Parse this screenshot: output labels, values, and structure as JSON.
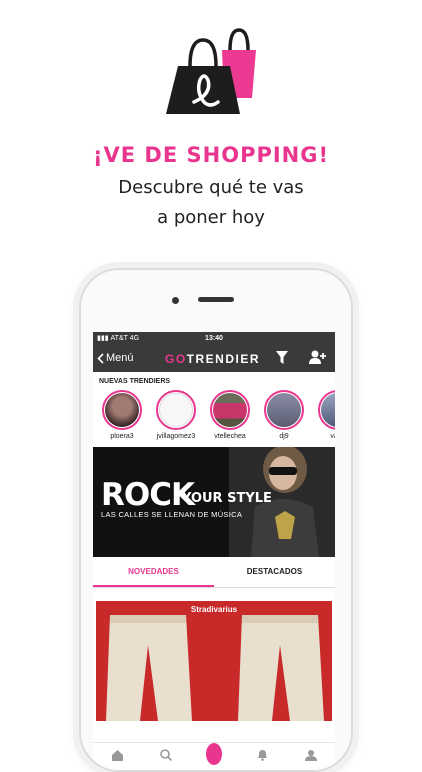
{
  "promo": {
    "headline": "¡VE DE SHOPPING!",
    "line1": "Descubre qué te vas",
    "line2": "a poner hoy",
    "accent_color": "#e8368f"
  },
  "status_bar": {
    "carrier": "AT&T 4G",
    "time": "13:40"
  },
  "nav": {
    "back_label": "Menú",
    "brand_go": "GO",
    "brand_rest": "TRENDIER",
    "filter_icon": "filter-icon",
    "add_user_icon": "add-user-icon"
  },
  "trendiers": {
    "label": "NUEVAS TRENDIERS",
    "users": [
      {
        "name": "ploera3"
      },
      {
        "name": "jvillagomez3"
      },
      {
        "name": "vtellechea"
      },
      {
        "name": "dj9"
      },
      {
        "name": "valer"
      }
    ]
  },
  "banner": {
    "big": "ROCK",
    "small": "YOUR STYLE",
    "tagline": "LAS CALLES  SE LLENAN DE MÚSICA"
  },
  "feed_tabs": [
    {
      "label": "NOVEDADES",
      "active": true
    },
    {
      "label": "DESTACADOS",
      "active": false
    }
  ],
  "product": {
    "store": "Stradivarius"
  },
  "tabbar": [
    "home-icon",
    "search-icon",
    "camera-icon",
    "bell-icon",
    "profile-icon"
  ]
}
